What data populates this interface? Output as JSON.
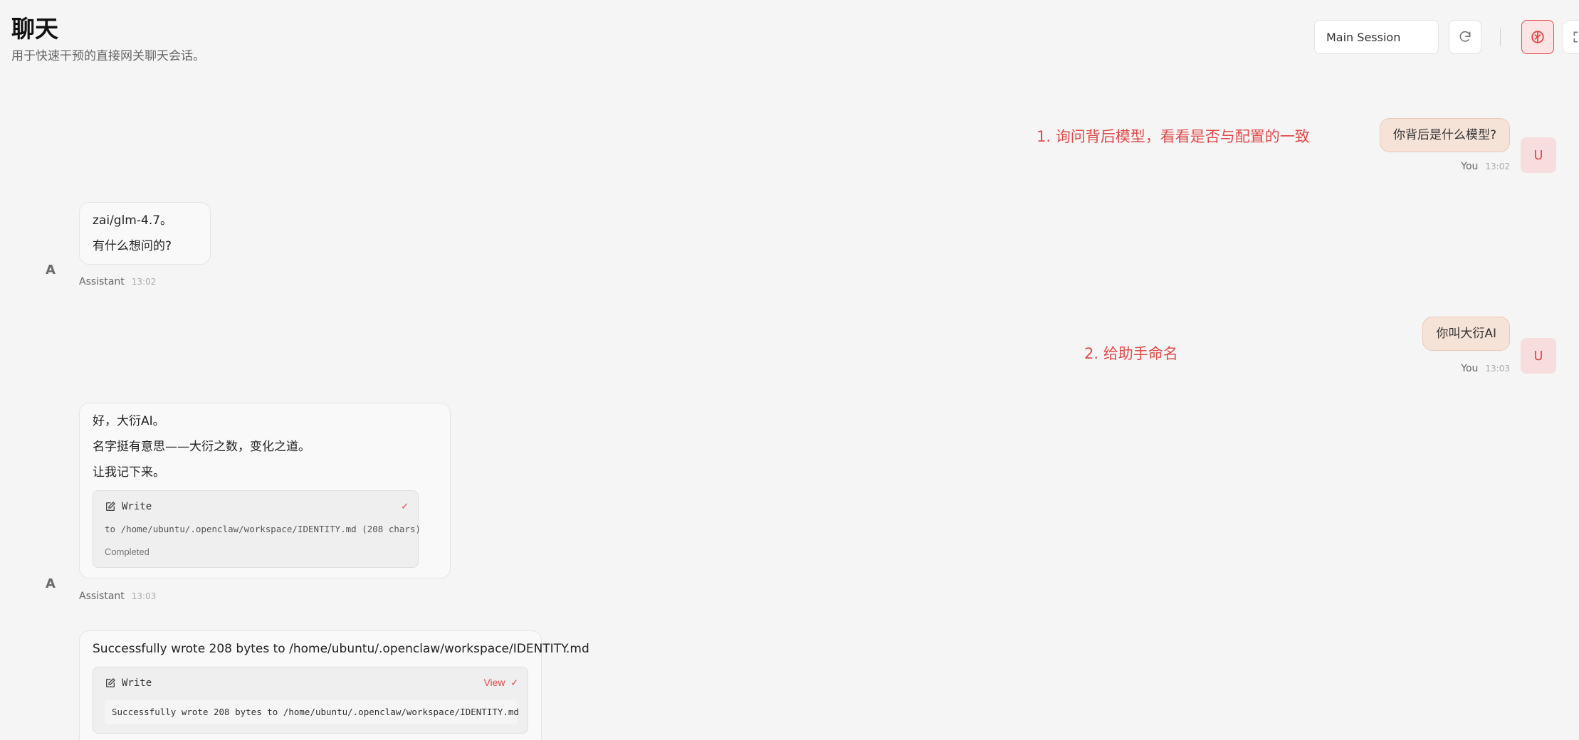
{
  "header": {
    "title": "聊天",
    "subtitle": "用于快速干预的直接网关聊天会话。",
    "session_label": "Main Session",
    "refresh_icon": "refresh-icon",
    "brain_icon": "brain-icon",
    "expand_icon": "expand-icon"
  },
  "annotations": {
    "first": "1. 询问背后模型，看看是否与配置的一致",
    "second": "2. 给助手命名"
  },
  "messages": [
    {
      "role": "user",
      "avatar": "U",
      "text": "你背后是什么模型?",
      "who": "You",
      "time": "13:02"
    },
    {
      "role": "assistant",
      "avatar": "A",
      "lines": [
        "zai/glm-4.7。",
        "有什么想问的?"
      ],
      "who": "Assistant",
      "time": "13:02"
    },
    {
      "role": "user",
      "avatar": "U",
      "text": "你叫大衍AI",
      "who": "You",
      "time": "13:03"
    },
    {
      "role": "assistant",
      "avatar": "A",
      "lines": [
        "好，大衍AI。",
        "名字挺有意思——大衍之数，变化之道。",
        "让我记下来。"
      ],
      "tool": {
        "name": "Write",
        "check": "✓",
        "desc": "to /home/ubuntu/.openclaw/workspace/IDENTITY.md (208 chars)",
        "status": "Completed"
      },
      "who": "Assistant",
      "time": "13:03"
    },
    {
      "role": "assistant",
      "lines": [
        "Successfully wrote 208 bytes to /home/ubuntu/.openclaw/workspace/IDENTITY.md"
      ],
      "tool": {
        "name": "Write",
        "view": "View",
        "check": "✓",
        "output": "Successfully wrote 208 bytes to /home/ubuntu/.openclaw/workspace/IDENTITY.md"
      }
    }
  ],
  "colors": {
    "accent": "#e04a4a",
    "user_bubble": "#f6e3d8",
    "background": "#f5f5f5"
  }
}
